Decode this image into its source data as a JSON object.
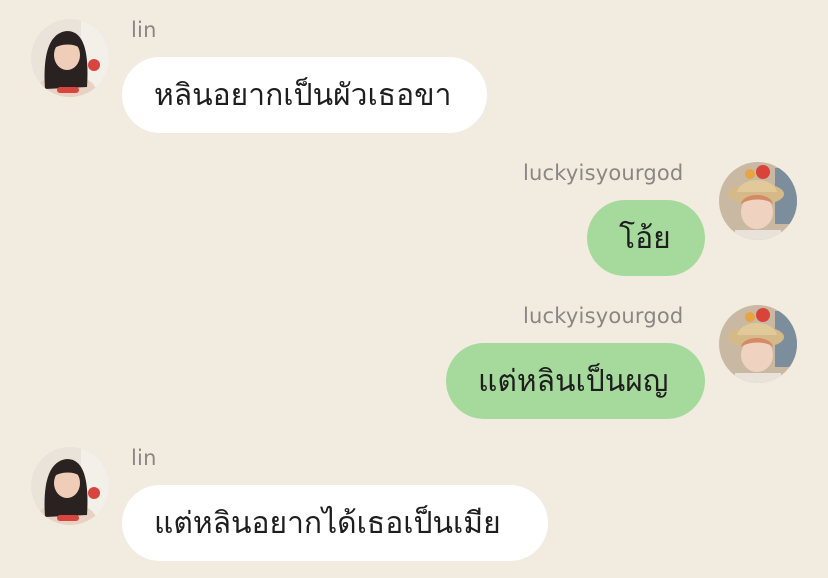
{
  "chat": {
    "messages": [
      {
        "sender": "lin",
        "side": "left",
        "text": "หลินอยากเป็นผัวเธอขา",
        "avatar": "lin-avatar"
      },
      {
        "sender": "luckyisyourgod",
        "side": "right",
        "text": "โอ้ย",
        "avatar": "luckyisyourgod-avatar"
      },
      {
        "sender": "luckyisyourgod",
        "side": "right",
        "text": "แต่หลินเป็นผญ",
        "avatar": "luckyisyourgod-avatar"
      },
      {
        "sender": "lin",
        "side": "left",
        "text": "แต่หลินอยากได้เธอเป็นเมีย",
        "avatar": "lin-avatar"
      }
    ]
  },
  "colors": {
    "background": "#f2ebe0",
    "incoming_bubble": "#ffffff",
    "outgoing_bubble": "#a6da9c",
    "sender_name": "#8a8782"
  }
}
